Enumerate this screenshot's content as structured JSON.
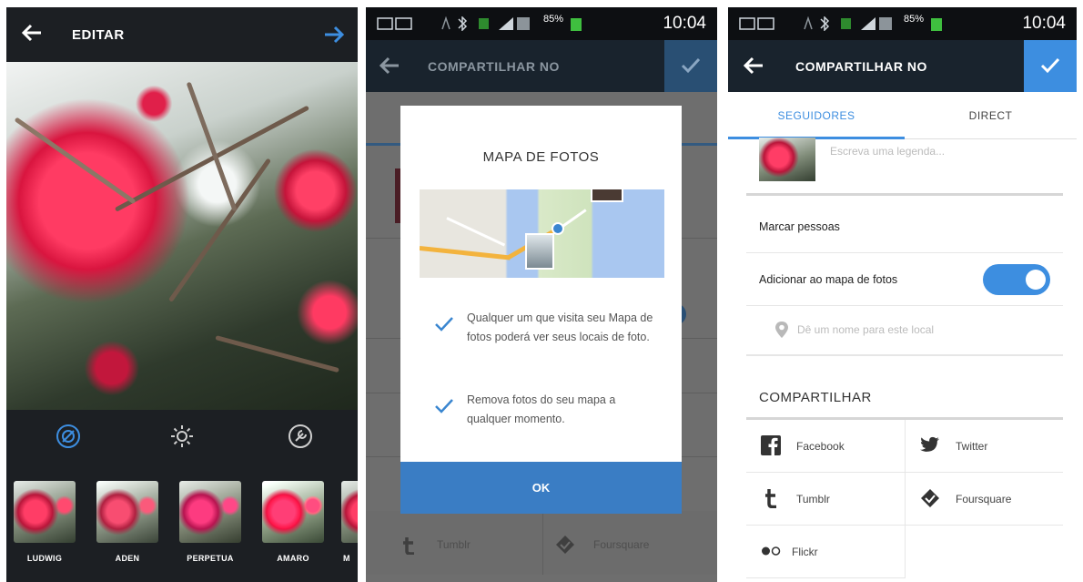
{
  "screen1": {
    "title": "EDITAR",
    "filters": [
      "LUDWIG",
      "ADEN",
      "PERPETUA",
      "AMARO",
      "M"
    ]
  },
  "status": {
    "battery": "85%",
    "time": "10:04"
  },
  "screen2": {
    "app_title": "COMPARTILHAR NO",
    "dialog": {
      "title": "MAPA DE FOTOS",
      "points": [
        "Qualquer um que visita seu Mapa de fotos poderá ver seus locais de foto.",
        "Remova fotos do seu mapa a qualquer momento."
      ],
      "ok_label": "OK"
    },
    "background_labels": [
      "Tumblr",
      "Foursquare"
    ]
  },
  "screen3": {
    "app_title": "COMPARTILHAR NO",
    "tabs": [
      "SEGUIDORES",
      "DIRECT"
    ],
    "caption_placeholder": "Escreva uma legenda...",
    "tag_people": "Marcar pessoas",
    "add_to_map": "Adicionar ao mapa de fotos",
    "add_to_map_enabled": true,
    "location_placeholder": "Dê um nome para este local",
    "share_title": "COMPARTILHAR",
    "share_targets": [
      "Facebook",
      "Twitter",
      "Tumblr",
      "Foursquare",
      "Flickr"
    ]
  },
  "colors": {
    "accent": "#3d8ee0",
    "dark_bar": "#19232d",
    "dialog_button": "#3a7dc4"
  },
  "icons": [
    "back-arrow-icon",
    "next-arrow-icon",
    "lux-icon",
    "brightness-icon",
    "tools-icon",
    "check-icon",
    "location-pin-icon",
    "facebook-icon",
    "twitter-icon",
    "tumblr-icon",
    "foursquare-icon",
    "flickr-icon"
  ]
}
